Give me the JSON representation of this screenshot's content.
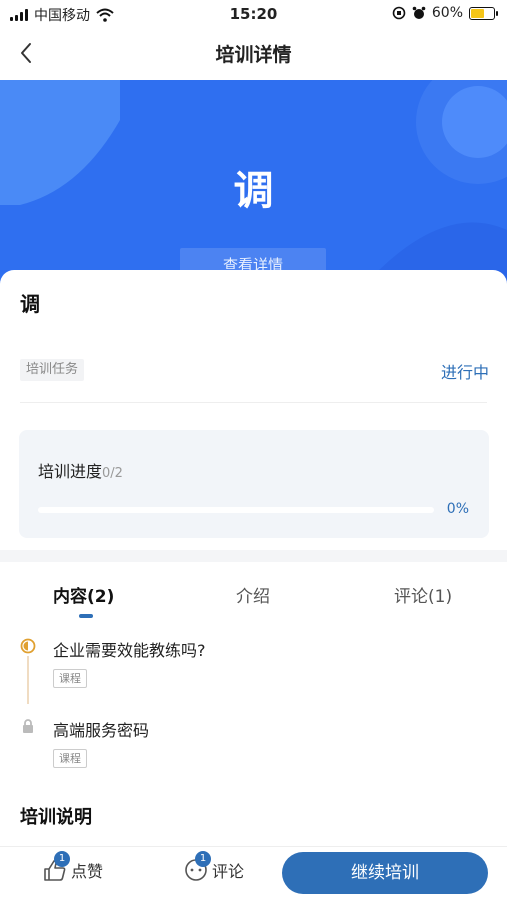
{
  "status_bar": {
    "carrier": "中国移动",
    "time": "15:20",
    "battery": "60%",
    "battery_level": 0.6
  },
  "nav": {
    "title": "培训详情",
    "back_icon": "chevron-left-icon"
  },
  "banner": {
    "title_char": "调",
    "view_detail": "查看详情",
    "color": "#2f6ff0"
  },
  "card": {
    "title": "调",
    "tag": "培训任务",
    "state": "进行中",
    "progress": {
      "label": "培训进度",
      "count": "0/2",
      "percent_text": "0%",
      "percent_value": 0
    }
  },
  "tabs": [
    {
      "label": "内容(2)",
      "active": true
    },
    {
      "label": "介绍",
      "active": false
    },
    {
      "label": "评论(1)",
      "active": false
    }
  ],
  "items": [
    {
      "title": "企业需要效能教练吗?",
      "tag": "课程",
      "icon": "in-progress-icon"
    },
    {
      "title": "高端服务密码",
      "tag": "课程",
      "icon": "lock-icon"
    }
  ],
  "section": {
    "title": "培训说明"
  },
  "bottom_bar": {
    "like": {
      "label": "点赞",
      "badge": "1"
    },
    "comment": {
      "label": "评论",
      "badge": "1"
    },
    "cta": "继续培训"
  },
  "colors": {
    "accent": "#2e6fb7",
    "banner": "#2f6ff0"
  }
}
